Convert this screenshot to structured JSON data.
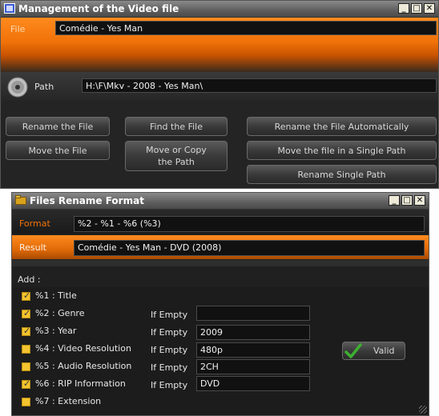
{
  "window1": {
    "title": "Management of the Video file",
    "file_label": "File",
    "file_value": "Comédie - Yes Man",
    "path_label": "Path",
    "path_value": "H:\\F\\Mkv - 2008 - Yes Man\\",
    "buttons": {
      "rename_file": "Rename the File",
      "find_file": "Find the File",
      "rename_auto": "Rename the File Automatically",
      "move_file": "Move the File",
      "move_copy_path_l1": "Move or Copy",
      "move_copy_path_l2": "the Path",
      "move_single_path": "Move the file in a Single Path",
      "rename_single_path": "Rename Single Path"
    }
  },
  "window2": {
    "title": "Files Rename Format",
    "format_label": "Format",
    "format_value": "%2 - %1 - %6 (%3)",
    "result_label": "Result",
    "result_value": "Comédie - Yes Man - DVD (2008)",
    "add_label": "Add :",
    "if_empty_label": "If Empty",
    "valid_label": "Valid",
    "options": [
      {
        "label": "%1 : Title",
        "checked": true
      },
      {
        "label": "%2 : Genre",
        "checked": true,
        "if_empty": ""
      },
      {
        "label": "%3 : Year",
        "checked": true,
        "if_empty": "2009"
      },
      {
        "label": "%4 : Video Resolution",
        "checked": false,
        "if_empty": "480p"
      },
      {
        "label": "%5 : Audio Resolution",
        "checked": false,
        "if_empty": "2CH"
      },
      {
        "label": "%6 : RIP Information",
        "checked": true,
        "if_empty": "DVD"
      },
      {
        "label": "%7 : Extension",
        "checked": false
      }
    ]
  },
  "colors": {
    "accent": "#f07208",
    "checkbox": "#f4c430",
    "valid_check": "#3cb030"
  }
}
